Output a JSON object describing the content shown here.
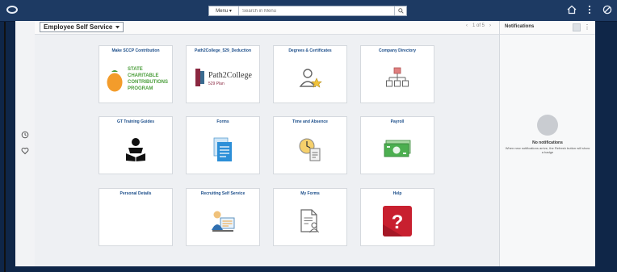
{
  "topbar": {
    "menu_label": "Menu ▾",
    "search_placeholder": "Search in Menu",
    "icons": [
      "home-icon",
      "more-icon",
      "no-entry-icon"
    ]
  },
  "header": {
    "homepage_name": "Employee Self Service",
    "pager": {
      "prev": "‹",
      "text": "1 of 5",
      "next": "›"
    }
  },
  "tiles": [
    {
      "title": "Make SCCP Contribution",
      "icon": "sccp-logo-icon",
      "logo_lines": [
        "STATE",
        "CHARITABLE",
        "CONTRIBUTIONS",
        "PROGRAM"
      ]
    },
    {
      "title": "Path2College_529_Deduction",
      "icon": "path2college-logo-icon",
      "logo_main": "Path2College",
      "logo_sub": "529 Plan"
    },
    {
      "title": "Degrees & Certificates",
      "icon": "person-star-icon"
    },
    {
      "title": "Company Directory",
      "icon": "org-chart-icon"
    },
    {
      "title": "GT Training Guides",
      "icon": "reading-person-icon"
    },
    {
      "title": "Forms",
      "icon": "forms-documents-icon"
    },
    {
      "title": "Time and Absence",
      "icon": "clock-document-icon"
    },
    {
      "title": "Payroll",
      "icon": "money-bill-icon"
    },
    {
      "title": "Personal Details",
      "icon": ""
    },
    {
      "title": "Recruiting Self Service",
      "icon": "recruiting-person-icon"
    },
    {
      "title": "My Forms",
      "icon": "document-person-icon"
    },
    {
      "title": "Help",
      "icon": "help-question-icon",
      "help_glyph": "?"
    }
  ],
  "notifications": {
    "title": "Notifications",
    "empty_title": "No notifications",
    "empty_desc": "When new notifications arrive, the Refresh button will show a badge"
  },
  "colors": {
    "topbar": "#1d3a63",
    "frame": "#0f2648",
    "tile_title": "#1c4e8a",
    "help_red": "#c8202f",
    "money_green": "#4caf50"
  }
}
